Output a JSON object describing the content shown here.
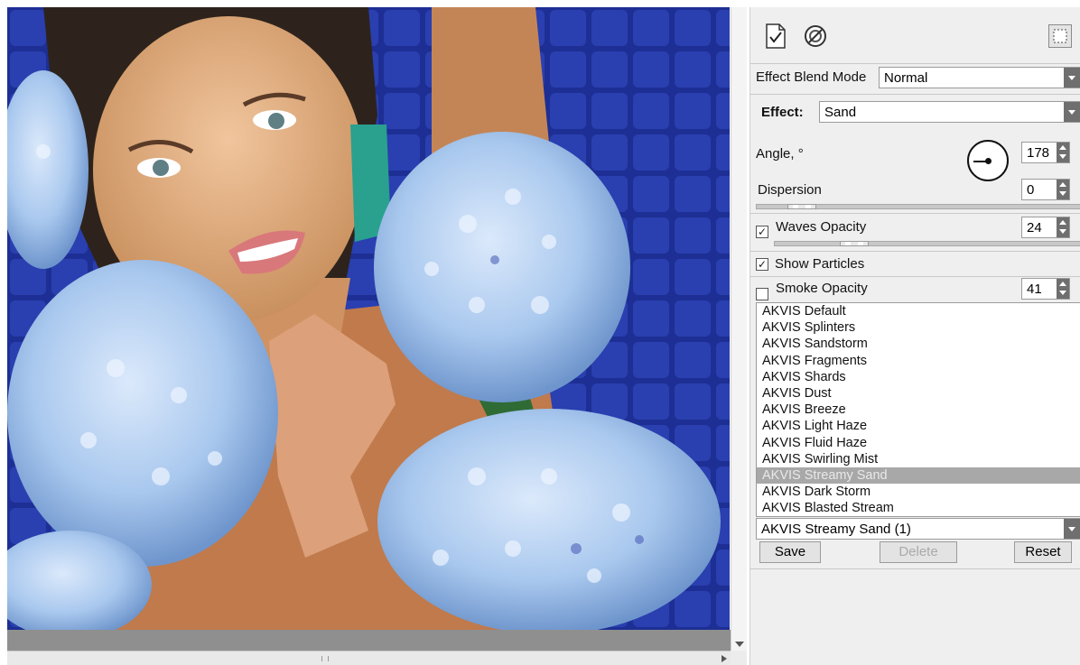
{
  "panel": {
    "toolbar": {
      "apply_icon": "apply-document-check-icon",
      "cancel_icon": "cancel-circle-slash-icon",
      "fit_icon": "fit-frame-icon"
    },
    "blend_mode": {
      "label": "Effect Blend Mode",
      "value": "Normal"
    },
    "effect": {
      "label": "Effect:",
      "value": "Sand"
    },
    "angle": {
      "label": "Angle, °",
      "value": "178"
    },
    "dispersion": {
      "label": "Dispersion",
      "value": "0"
    },
    "waves_opacity": {
      "label": "Waves Opacity",
      "value": "24",
      "checked": true
    },
    "show_particles": {
      "label": "Show Particles",
      "checked": true
    },
    "smoke_opacity": {
      "label": "Smoke Opacity",
      "value": "41",
      "checked": false
    },
    "presets": {
      "items": [
        "AKVIS Default",
        "AKVIS Splinters",
        "AKVIS Sandstorm",
        "AKVIS Fragments",
        "AKVIS Shards",
        "AKVIS Dust",
        "AKVIS Breeze",
        "AKVIS Light Haze",
        "AKVIS Fluid Haze",
        "AKVIS Swirling Mist",
        "AKVIS Streamy Sand",
        "AKVIS Dark Storm",
        "AKVIS Blasted Stream"
      ],
      "selected_index": 10,
      "current": "AKVIS Streamy Sand (1)"
    },
    "buttons": {
      "save": "Save",
      "delete": "Delete",
      "reset": "Reset"
    }
  },
  "colors": {
    "panel_bg": "#efefef",
    "selection": "#a8a8a8",
    "pool_blue": "#1b2c8c",
    "flower_blue": "#a9c8ee"
  }
}
